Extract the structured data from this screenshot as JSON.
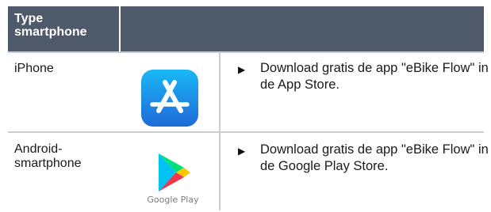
{
  "table": {
    "header": {
      "type_label": "Type smartphone"
    },
    "rows": [
      {
        "type": "iPhone",
        "icon": "app-store-icon",
        "instruction": "Download gratis de app \"eBike Flow\" in de App Store."
      },
      {
        "type": "Android-smartphone",
        "icon": "google-play-icon",
        "icon_label": "Google Play",
        "instruction": "Download gratis de app \"eBike Flow\" in de Google Play Store."
      }
    ]
  },
  "colors": {
    "header_bg": "#4e5a6a",
    "app_store_gradient_top": "#19b8f6",
    "app_store_gradient_bottom": "#1e6ad8"
  }
}
